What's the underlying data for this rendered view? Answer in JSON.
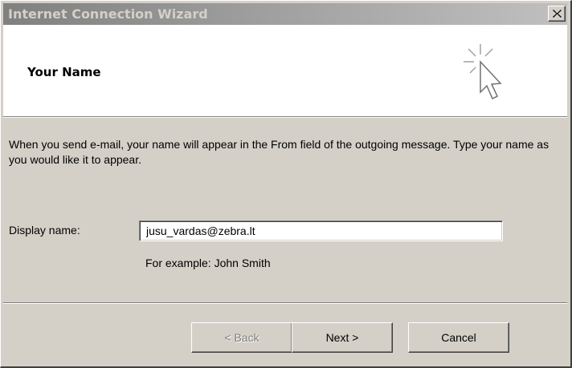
{
  "window": {
    "title": "Internet Connection Wizard"
  },
  "header": {
    "title": "Your Name"
  },
  "content": {
    "description": "When you send e-mail, your name will appear in the From field of the outgoing message. Type your name as you would like it to appear.",
    "display_name_label": "Display name:",
    "display_name_value": "jusu_vardas@zebra.lt",
    "example_text": "For example: John Smith"
  },
  "buttons": {
    "back_label": "< Back",
    "next_label": "Next >",
    "cancel_label": "Cancel",
    "back_enabled": false
  },
  "icons": {
    "close": "close-icon",
    "wizard": "wizard-cursor-icon"
  },
  "colors": {
    "dialog_face": "#d4d0c8",
    "titlebar_inactive": "#808080",
    "header_bg": "#ffffff"
  }
}
